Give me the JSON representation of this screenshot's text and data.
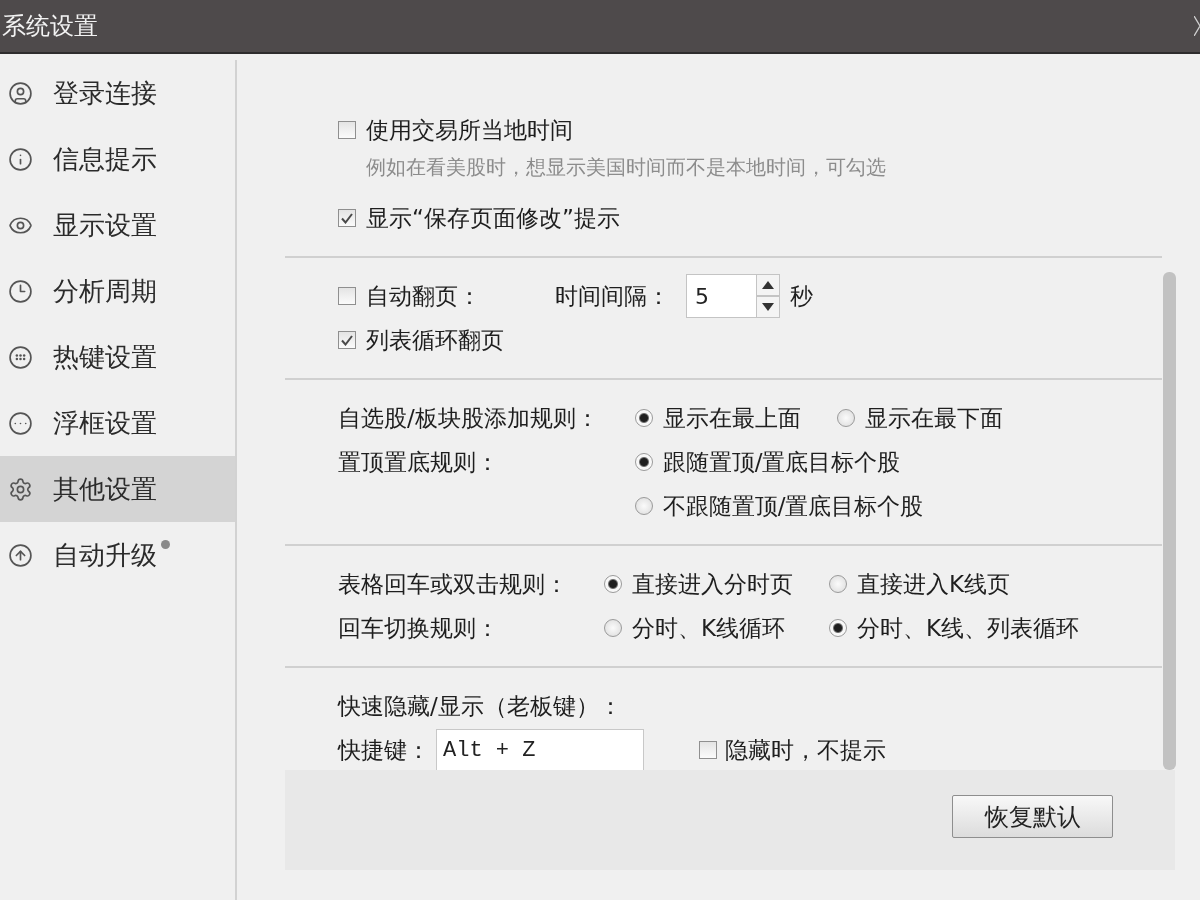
{
  "window": {
    "title": "系统设置"
  },
  "sidebar": {
    "items": [
      {
        "label": "登录连接",
        "selected": false,
        "dot": false
      },
      {
        "label": "信息提示",
        "selected": false,
        "dot": false
      },
      {
        "label": "显示设置",
        "selected": false,
        "dot": false
      },
      {
        "label": "分析周期",
        "selected": false,
        "dot": false
      },
      {
        "label": "热键设置",
        "selected": false,
        "dot": false
      },
      {
        "label": "浮框设置",
        "selected": false,
        "dot": false
      },
      {
        "label": "其他设置",
        "selected": true,
        "dot": false
      },
      {
        "label": "自动升级",
        "selected": false,
        "dot": true
      }
    ]
  },
  "sections": [
    {
      "rows": [
        {
          "kind": "checkbox",
          "label": "使用交易所当地时间",
          "checked": false,
          "hint": "例如在看美股时，想显示美国时间而不是本地时间，可勾选"
        },
        {
          "kind": "checkbox",
          "label": "显示“保存页面修改”提示",
          "checked": true
        }
      ]
    },
    {
      "rows": [
        {
          "kind": "checkbox",
          "label": "自动翻页：",
          "checked": false,
          "interval": {
            "label": "时间间隔：",
            "value": "5",
            "unit": "秒"
          }
        },
        {
          "kind": "checkbox",
          "label": "列表循环翻页",
          "checked": true
        }
      ]
    },
    {
      "rows": [
        {
          "kind": "radio_row",
          "label": "自选股/板块股添加规则：",
          "options": [
            {
              "label": "显示在最上面",
              "selected": true
            },
            {
              "label": "显示在最下面",
              "selected": false
            }
          ]
        },
        {
          "kind": "radio_column",
          "label": "置顶置底规则：",
          "options": [
            {
              "label": "跟随置顶/置底目标个股",
              "selected": true
            },
            {
              "label": "不跟随置顶/置底目标个股",
              "selected": false
            }
          ]
        }
      ]
    },
    {
      "rows": [
        {
          "kind": "radio_row",
          "label": "表格回车或双击规则：",
          "options": [
            {
              "label": "直接进入分时页",
              "selected": true
            },
            {
              "label": "直接进入K线页",
              "selected": false
            }
          ]
        },
        {
          "kind": "radio_row",
          "label": "回车切换规则：",
          "options": [
            {
              "label": "分时、K线循环",
              "selected": false
            },
            {
              "label": "分时、K线、列表循环",
              "selected": true
            }
          ]
        }
      ]
    },
    {
      "rows": [
        {
          "kind": "heading",
          "label": "快速隐藏/显示（老板键）："
        },
        {
          "kind": "hotkey",
          "label": "快捷键：",
          "value": "Alt + Z",
          "option": {
            "label": "隐藏时，不提示",
            "checked": false
          }
        }
      ]
    }
  ],
  "footer": {
    "button": "恢复默认"
  }
}
